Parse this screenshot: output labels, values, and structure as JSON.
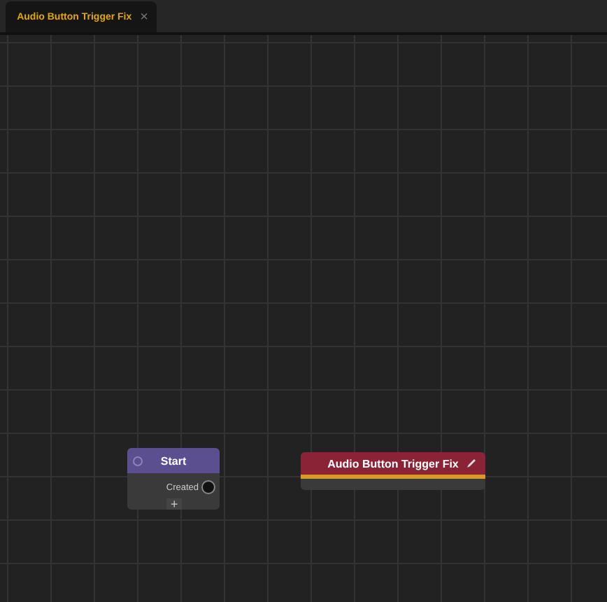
{
  "tabs": [
    {
      "label": "Audio Button Trigger Fix",
      "close": "×",
      "selected": true
    }
  ],
  "nodes": [
    {
      "kind": "start",
      "title": "Start",
      "port": "Created",
      "add": "+",
      "color": "#5b4f8f"
    },
    {
      "kind": "action",
      "title": "Audio Button Trigger Fix",
      "color": "#8a2336"
    }
  ]
}
